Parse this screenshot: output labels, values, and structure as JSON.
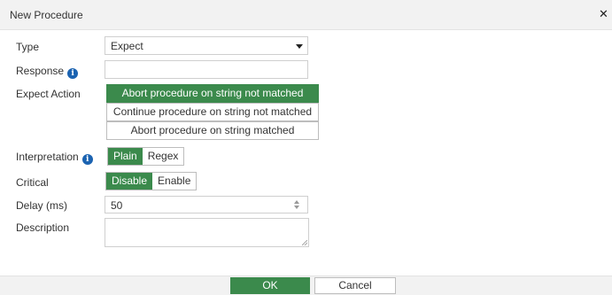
{
  "dialog": {
    "title": "New Procedure",
    "close_glyph": "✕",
    "close_icon": "close-icon"
  },
  "form": {
    "type": {
      "label": "Type",
      "value": "Expect"
    },
    "response": {
      "label": "Response",
      "value": "",
      "info_icon": "info-icon"
    },
    "expect_action": {
      "label": "Expect Action",
      "options": [
        "Abort procedure on string not matched",
        "Continue procedure on string not matched",
        "Abort procedure on string matched"
      ],
      "selected": "Abort procedure on string not matched"
    },
    "interpretation": {
      "label": "Interpretation",
      "info_icon": "info-icon",
      "options": [
        "Plain",
        "Regex"
      ],
      "selected": "Plain"
    },
    "critical": {
      "label": "Critical",
      "options": [
        "Disable",
        "Enable"
      ],
      "selected": "Disable"
    },
    "delay": {
      "label": "Delay (ms)",
      "value": "50"
    },
    "description": {
      "label": "Description",
      "value": ""
    }
  },
  "footer": {
    "ok_label": "OK",
    "cancel_label": "Cancel"
  },
  "colors": {
    "accent": "#3b8a4c",
    "info": "#1b63b1",
    "header_bg": "#f2f2f2"
  }
}
